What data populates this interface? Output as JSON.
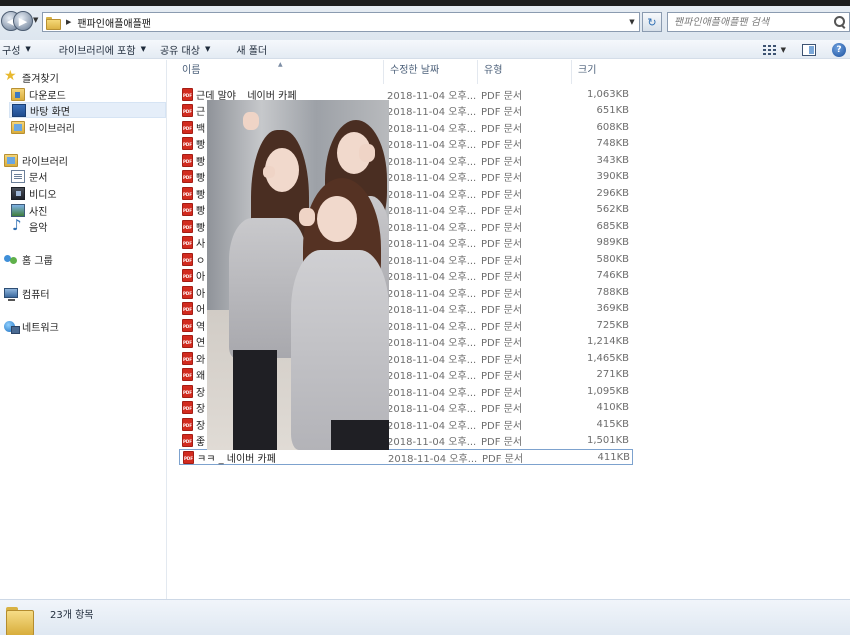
{
  "address_bar": {
    "path": "팬파인애플애플팬",
    "search_placeholder": "팬파인애플애플팬 검색"
  },
  "toolbar": {
    "organize": "구성",
    "include_library": "라이브러리에 포함",
    "share": "공유 대상",
    "new_folder": "새 폴더"
  },
  "nav_pane": {
    "favorites": {
      "label": "즐겨찾기",
      "items": [
        {
          "label": "다운로드",
          "icon": "download-folder-icon"
        },
        {
          "label": "바탕 화면",
          "icon": "desktop-icon",
          "selected": true
        },
        {
          "label": "라이브러리",
          "icon": "library-folder-icon"
        }
      ]
    },
    "libraries": {
      "label": "라이브러리",
      "items": [
        {
          "label": "문서",
          "icon": "documents-icon"
        },
        {
          "label": "비디오",
          "icon": "video-icon"
        },
        {
          "label": "사진",
          "icon": "pictures-icon"
        },
        {
          "label": "음악",
          "icon": "music-icon"
        }
      ]
    },
    "homegroup": "홈 그룹",
    "computer": "컴퓨터",
    "network": "네트워크"
  },
  "columns": {
    "name": "이름",
    "date": "수정한 날짜",
    "type": "유형",
    "size": "크기"
  },
  "files": [
    {
      "name": "근데 말야 _ 네이버 카페",
      "date": "2018-11-04 오후...",
      "type": "PDF 문서",
      "size": "1,063KB"
    },
    {
      "name": "근",
      "date": "2018-11-04 오후...",
      "type": "PDF 문서",
      "size": "651KB"
    },
    {
      "name": "백",
      "date": "2018-11-04 오후...",
      "type": "PDF 문서",
      "size": "608KB"
    },
    {
      "name": "빵",
      "date": "2018-11-04 오후...",
      "type": "PDF 문서",
      "size": "748KB"
    },
    {
      "name": "빵",
      "date": "2018-11-04 오후...",
      "type": "PDF 문서",
      "size": "343KB"
    },
    {
      "name": "빵",
      "date": "2018-11-04 오후...",
      "type": "PDF 문서",
      "size": "390KB"
    },
    {
      "name": "빵",
      "date": "2018-11-04 오후...",
      "type": "PDF 문서",
      "size": "296KB"
    },
    {
      "name": "빵",
      "date": "2018-11-04 오후...",
      "type": "PDF 문서",
      "size": "562KB"
    },
    {
      "name": "빵",
      "date": "2018-11-04 오후...",
      "type": "PDF 문서",
      "size": "685KB"
    },
    {
      "name": "사",
      "date": "2018-11-04 오후...",
      "type": "PDF 문서",
      "size": "989KB"
    },
    {
      "name": "ㅇ",
      "date": "2018-11-04 오후...",
      "type": "PDF 문서",
      "size": "580KB"
    },
    {
      "name": "아",
      "date": "2018-11-04 오후...",
      "type": "PDF 문서",
      "size": "746KB"
    },
    {
      "name": "아",
      "date": "2018-11-04 오후...",
      "type": "PDF 문서",
      "size": "788KB"
    },
    {
      "name": "어",
      "date": "2018-11-04 오후...",
      "type": "PDF 문서",
      "size": "369KB"
    },
    {
      "name": "역",
      "date": "2018-11-04 오후...",
      "type": "PDF 문서",
      "size": "725KB"
    },
    {
      "name": "연",
      "date": "2018-11-04 오후...",
      "type": "PDF 문서",
      "size": "1,214KB"
    },
    {
      "name": "와",
      "date": "2018-11-04 오후...",
      "type": "PDF 문서",
      "size": "1,465KB"
    },
    {
      "name": "왜",
      "date": "2018-11-04 오후...",
      "type": "PDF 문서",
      "size": "271KB"
    },
    {
      "name": "장",
      "date": "2018-11-04 오후...",
      "type": "PDF 문서",
      "size": "1,095KB"
    },
    {
      "name": "장",
      "date": "2018-11-04 오후...",
      "type": "PDF 문서",
      "size": "410KB"
    },
    {
      "name": "장",
      "date": "2018-11-04 오후...",
      "type": "PDF 문서",
      "size": "415KB"
    },
    {
      "name": "좋",
      "date": "2018-11-04 오후...",
      "type": "PDF 문서",
      "size": "1,501KB"
    },
    {
      "name": "ㅋㅋ _ 네이버 카페",
      "date": "2018-11-04 오후...",
      "type": "PDF 문서",
      "size": "411KB",
      "selected": true
    }
  ],
  "status": {
    "item_count": "23개 항목"
  },
  "colors": {
    "selection_border": "#7da2ce",
    "nav_selected_bg": "#e5eef9",
    "pdf_red": "#d22b1f",
    "header_text": "#4c607a"
  }
}
